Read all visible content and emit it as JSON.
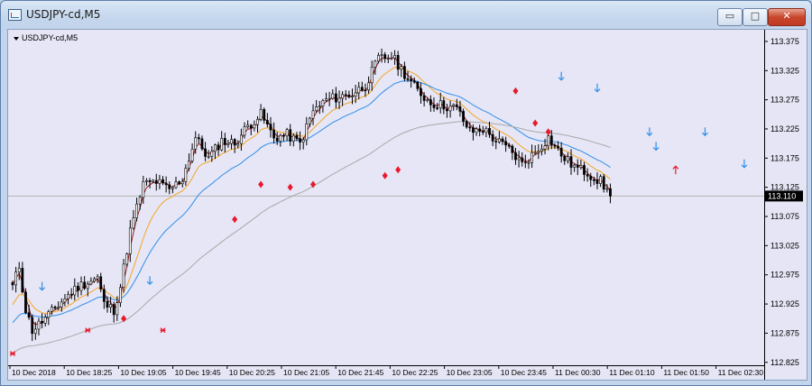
{
  "window": {
    "title": "USDJPY-cd,M5",
    "min_glyph": "▭",
    "max_glyph": "□",
    "close_glyph": "✕"
  },
  "chart_label": "USDJPY-cd,M5",
  "colors": {
    "plot_bg": "#e6e6f6",
    "bull_body": "#ffffff",
    "bear_body": "#000000",
    "wick": "#000000",
    "ma_fast": "#9b1c1c",
    "ma_mid": "#f5a623",
    "ma_slow": "#2f8fe8",
    "ma_long": "#a8a8a8",
    "signal_diamond": "#e8192c",
    "signal_star": "#e8192c",
    "arrow_down": "#2f8fe8",
    "arrow_up": "#e8192c",
    "price_line": "#b4b4b4",
    "current_price_bg": "#000000",
    "current_price_fg": "#ffffff"
  },
  "chart_data": {
    "type": "candlestick",
    "symbol": "USDJPY-cd",
    "timeframe": "M5",
    "ylim": [
      112.82,
      113.395
    ],
    "yticks": [
      113.375,
      113.325,
      113.275,
      113.225,
      113.175,
      113.125,
      113.075,
      113.025,
      112.975,
      112.925,
      112.875,
      112.825
    ],
    "xticks": [
      "10 Dec 2018",
      "10 Dec 18:25",
      "10 Dec 19:05",
      "10 Dec 19:45",
      "10 Dec 20:25",
      "10 Dec 21:05",
      "10 Dec 21:45",
      "10 Dec 22:25",
      "10 Dec 23:05",
      "10 Dec 23:45",
      "11 Dec 00:30",
      "11 Dec 01:10",
      "11 Dec 01:50",
      "11 Dec 02:30"
    ],
    "current_price": 113.11,
    "anchors": [
      [
        0,
        112.955
      ],
      [
        2,
        112.99
      ],
      [
        4,
        112.915
      ],
      [
        6,
        112.88
      ],
      [
        10,
        112.9
      ],
      [
        16,
        112.935
      ],
      [
        20,
        112.955
      ],
      [
        26,
        112.97
      ],
      [
        28,
        112.925
      ],
      [
        31,
        112.915
      ],
      [
        33,
        112.955
      ],
      [
        36,
        113.05
      ],
      [
        40,
        113.13
      ],
      [
        44,
        113.135
      ],
      [
        48,
        113.12
      ],
      [
        52,
        113.14
      ],
      [
        56,
        113.21
      ],
      [
        60,
        113.175
      ],
      [
        64,
        113.205
      ],
      [
        68,
        113.2
      ],
      [
        72,
        113.23
      ],
      [
        76,
        113.25
      ],
      [
        80,
        113.21
      ],
      [
        84,
        113.215
      ],
      [
        88,
        113.2
      ],
      [
        92,
        113.255
      ],
      [
        96,
        113.275
      ],
      [
        100,
        113.28
      ],
      [
        104,
        113.285
      ],
      [
        108,
        113.3
      ],
      [
        112,
        113.345
      ],
      [
        116,
        113.35
      ],
      [
        120,
        113.32
      ],
      [
        124,
        113.29
      ],
      [
        128,
        113.27
      ],
      [
        132,
        113.265
      ],
      [
        136,
        113.26
      ],
      [
        140,
        113.22
      ],
      [
        144,
        113.225
      ],
      [
        148,
        113.205
      ],
      [
        152,
        113.19
      ],
      [
        156,
        113.165
      ],
      [
        160,
        113.185
      ],
      [
        164,
        113.21
      ],
      [
        168,
        113.18
      ],
      [
        172,
        113.16
      ],
      [
        176,
        113.15
      ],
      [
        180,
        113.135
      ],
      [
        183,
        113.11
      ]
    ],
    "moving_averages": [
      {
        "color_key": "ma_fast",
        "period": 3
      },
      {
        "color_key": "ma_mid",
        "period": 12
      },
      {
        "color_key": "ma_slow",
        "period": 26
      },
      {
        "color_key": "ma_long",
        "period": 80
      }
    ],
    "signals": [
      {
        "kind": "star",
        "bar": 0,
        "price": 112.84
      },
      {
        "kind": "arrow_down",
        "bar": 9,
        "price": 112.955
      },
      {
        "kind": "star",
        "bar": 23,
        "price": 112.88
      },
      {
        "kind": "diamond",
        "bar": 34,
        "price": 112.9
      },
      {
        "kind": "arrow_down",
        "bar": 42,
        "price": 112.965
      },
      {
        "kind": "star",
        "bar": 46,
        "price": 112.88
      },
      {
        "kind": "diamond",
        "bar": 68,
        "price": 113.07
      },
      {
        "kind": "diamond",
        "bar": 76,
        "price": 113.13
      },
      {
        "kind": "diamond",
        "bar": 85,
        "price": 113.125
      },
      {
        "kind": "diamond",
        "bar": 92,
        "price": 113.13
      },
      {
        "kind": "diamond",
        "bar": 114,
        "price": 113.145
      },
      {
        "kind": "diamond",
        "bar": 118,
        "price": 113.155
      },
      {
        "kind": "diamond",
        "bar": 154,
        "price": 113.29
      },
      {
        "kind": "diamond",
        "bar": 160,
        "price": 113.235
      },
      {
        "kind": "diamond",
        "bar": 164,
        "price": 113.22
      },
      {
        "kind": "arrow_down",
        "bar": 168,
        "price": 113.315
      },
      {
        "kind": "arrow_down",
        "bar": 179,
        "price": 113.295
      },
      {
        "kind": "arrow_down",
        "bar": 195,
        "price": 113.22
      },
      {
        "kind": "arrow_down",
        "bar": 197,
        "price": 113.195
      },
      {
        "kind": "arrow_down",
        "bar": 212,
        "price": 113.22
      },
      {
        "kind": "arrow_up",
        "bar": 203,
        "price": 113.155
      },
      {
        "kind": "arrow_down",
        "bar": 224,
        "price": 113.165
      }
    ]
  }
}
